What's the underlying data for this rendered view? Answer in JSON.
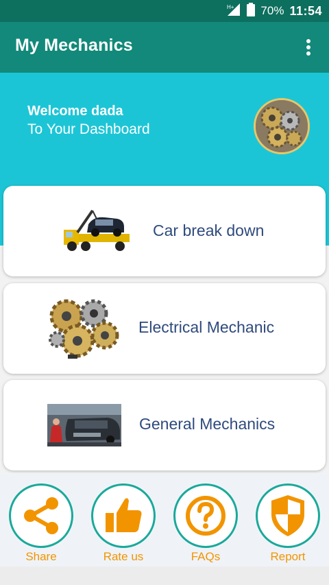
{
  "status_bar": {
    "network": "H+",
    "battery": "70%",
    "time": "11:54"
  },
  "app_bar": {
    "title": "My Mechanics",
    "menu_icon": "more-vert-icon"
  },
  "welcome": {
    "title": "Welcome dada",
    "subtitle": "To Your Dashboard"
  },
  "cards": [
    {
      "label": "Car break down",
      "icon": "tow-truck-image"
    },
    {
      "label": "Electrical Mechanic",
      "icon": "gears-image"
    },
    {
      "label": "General Mechanics",
      "icon": "car-repair-image"
    }
  ],
  "bottom_nav": [
    {
      "label": "Share",
      "icon": "share-icon"
    },
    {
      "label": "Rate us",
      "icon": "thumbs-up-icon"
    },
    {
      "label": "FAQs",
      "icon": "question-icon"
    },
    {
      "label": "Report",
      "icon": "shield-icon"
    }
  ],
  "colors": {
    "status_bar": "#0d6f5e",
    "app_bar": "#12897a",
    "welcome_bg": "#1cc5d6",
    "card_text": "#2e4a7d",
    "nav_accent": "#f29400",
    "nav_ring": "#1aa99a"
  }
}
